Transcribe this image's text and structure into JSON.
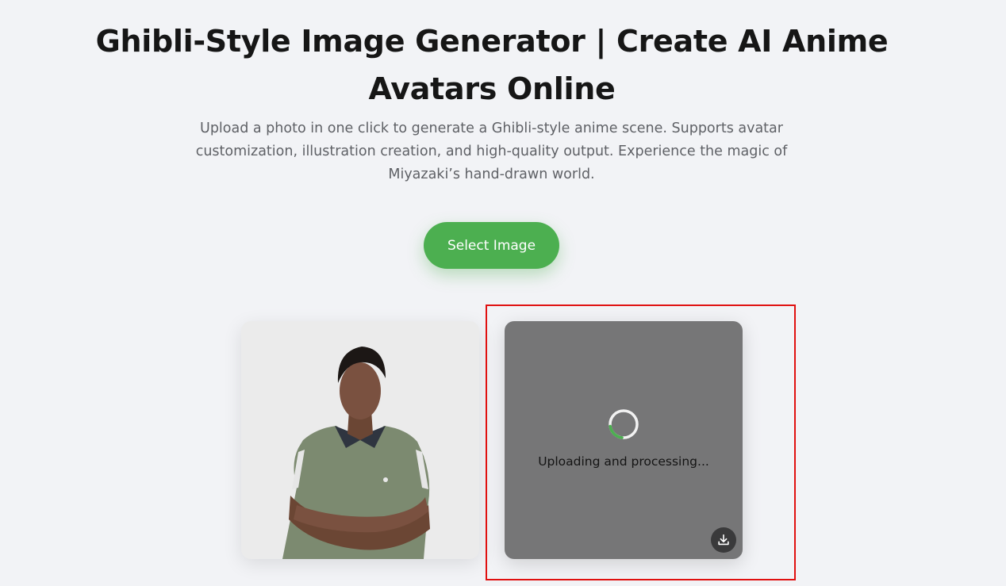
{
  "header": {
    "title": "Ghibli-Style Image Generator | Create AI Anime Avatars Online",
    "subtitle": "Upload a photo in one click to generate a Ghibli-style anime scene. Supports avatar customization, illustration creation, and high-quality output. Experience the magic of Miyazaki’s hand-drawn world."
  },
  "upload": {
    "select_label": "Select Image"
  },
  "result": {
    "status_text": "Uploading and processing...",
    "download_icon": "download-icon",
    "spinner_icon": "loading-spinner-icon"
  },
  "colors": {
    "accent": "#4caf50",
    "page_background": "#f2f3f6",
    "result_background": "#767677",
    "highlight": "#e01010"
  }
}
